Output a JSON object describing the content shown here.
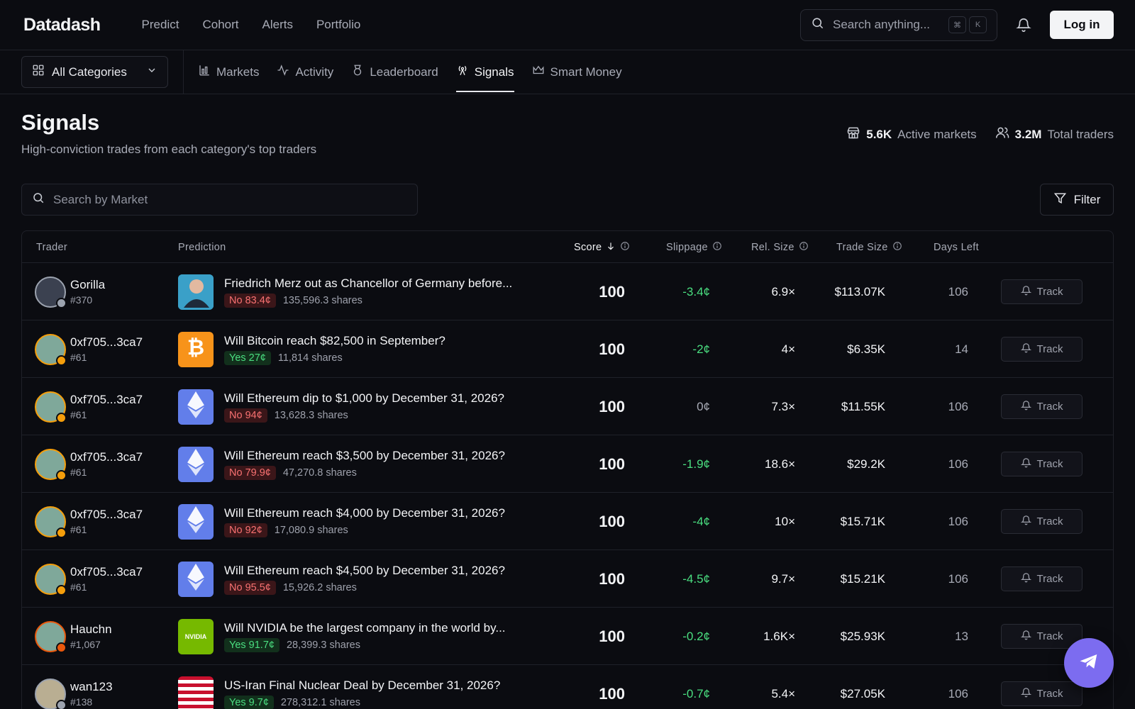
{
  "app": {
    "logo": "Datadash"
  },
  "topnav": {
    "items": [
      "Predict",
      "Cohort",
      "Alerts",
      "Portfolio"
    ]
  },
  "search": {
    "placeholder": "Search anything...",
    "kbd1": "⌘",
    "kbd2": "K"
  },
  "auth": {
    "login_label": "Log in"
  },
  "categories": {
    "selected": "All Categories"
  },
  "tabs": [
    {
      "label": "Markets",
      "icon": "chart-icon"
    },
    {
      "label": "Activity",
      "icon": "activity-icon"
    },
    {
      "label": "Leaderboard",
      "icon": "medal-icon"
    },
    {
      "label": "Signals",
      "icon": "broadcast-icon"
    },
    {
      "label": "Smart Money",
      "icon": "crown-icon"
    }
  ],
  "page": {
    "title": "Signals",
    "subtitle": "High-conviction trades from each category's top traders"
  },
  "stats": {
    "markets_value": "5.6K",
    "markets_label": "Active markets",
    "traders_value": "3.2M",
    "traders_label": "Total traders"
  },
  "market_search": {
    "placeholder": "Search by Market"
  },
  "filter": {
    "label": "Filter"
  },
  "columns": {
    "trader": "Trader",
    "prediction": "Prediction",
    "score": "Score",
    "slippage": "Slippage",
    "rel_size": "Rel. Size",
    "trade_size": "Trade Size",
    "days_left": "Days Left"
  },
  "track_label": "Track",
  "rows": [
    {
      "trader": "Gorilla",
      "rank": "#370",
      "avatar": "silver",
      "image": "merz",
      "question": "Friedrich Merz out as Chancellor of Germany before...",
      "side": "no",
      "pill": "No 83.4¢",
      "shares": "135,596.3 shares",
      "score": "100",
      "slippage": "-3.4¢",
      "rel_size": "6.9×",
      "trade_size": "$113.07K",
      "days_left": "106"
    },
    {
      "trader": "0xf705...3ca7",
      "rank": "#61",
      "avatar": "gold",
      "image": "btc",
      "question": "Will Bitcoin reach $82,500 in September?",
      "side": "yes",
      "pill": "Yes 27¢",
      "shares": "11,814 shares",
      "score": "100",
      "slippage": "-2¢",
      "rel_size": "4×",
      "trade_size": "$6.35K",
      "days_left": "14"
    },
    {
      "trader": "0xf705...3ca7",
      "rank": "#61",
      "avatar": "gold",
      "image": "eth",
      "question": "Will Ethereum dip to $1,000 by December 31, 2026?",
      "side": "no",
      "pill": "No 94¢",
      "shares": "13,628.3 shares",
      "score": "100",
      "slippage": "0¢",
      "rel_size": "7.3×",
      "trade_size": "$11.55K",
      "days_left": "106"
    },
    {
      "trader": "0xf705...3ca7",
      "rank": "#61",
      "avatar": "gold",
      "image": "eth",
      "question": "Will Ethereum reach $3,500 by December 31, 2026?",
      "side": "no",
      "pill": "No 79.9¢",
      "shares": "47,270.8 shares",
      "score": "100",
      "slippage": "-1.9¢",
      "rel_size": "18.6×",
      "trade_size": "$29.2K",
      "days_left": "106"
    },
    {
      "trader": "0xf705...3ca7",
      "rank": "#61",
      "avatar": "gold",
      "image": "eth",
      "question": "Will Ethereum reach $4,000 by December 31, 2026?",
      "side": "no",
      "pill": "No 92¢",
      "shares": "17,080.9 shares",
      "score": "100",
      "slippage": "-4¢",
      "rel_size": "10×",
      "trade_size": "$15.71K",
      "days_left": "106"
    },
    {
      "trader": "0xf705...3ca7",
      "rank": "#61",
      "avatar": "gold",
      "image": "eth",
      "question": "Will Ethereum reach $4,500 by December 31, 2026?",
      "side": "no",
      "pill": "No 95.5¢",
      "shares": "15,926.2 shares",
      "score": "100",
      "slippage": "-4.5¢",
      "rel_size": "9.7×",
      "trade_size": "$15.21K",
      "days_left": "106"
    },
    {
      "trader": "Hauchn",
      "rank": "#1,067",
      "avatar": "bronze",
      "image": "nv",
      "image_text": "NVIDIA",
      "question": "Will NVIDIA be the largest company in the world by...",
      "side": "yes",
      "pill": "Yes 91.7¢",
      "shares": "28,399.3 shares",
      "score": "100",
      "slippage": "-0.2¢",
      "rel_size": "1.6K×",
      "trade_size": "$25.93K",
      "days_left": "13"
    },
    {
      "trader": "wan123",
      "rank": "#138",
      "avatar": "tan",
      "image": "flag",
      "question": "US-Iran Final Nuclear Deal by December 31, 2026?",
      "side": "yes",
      "pill": "Yes 9.7¢",
      "shares": "278,312.1 shares",
      "score": "100",
      "slippage": "-0.7¢",
      "rel_size": "5.4×",
      "trade_size": "$27.05K",
      "days_left": "106"
    }
  ],
  "colors": {
    "background": "#0b0c11",
    "accent": "#7c6cf0",
    "positive": "#4ade80",
    "negative": "#f87171"
  }
}
